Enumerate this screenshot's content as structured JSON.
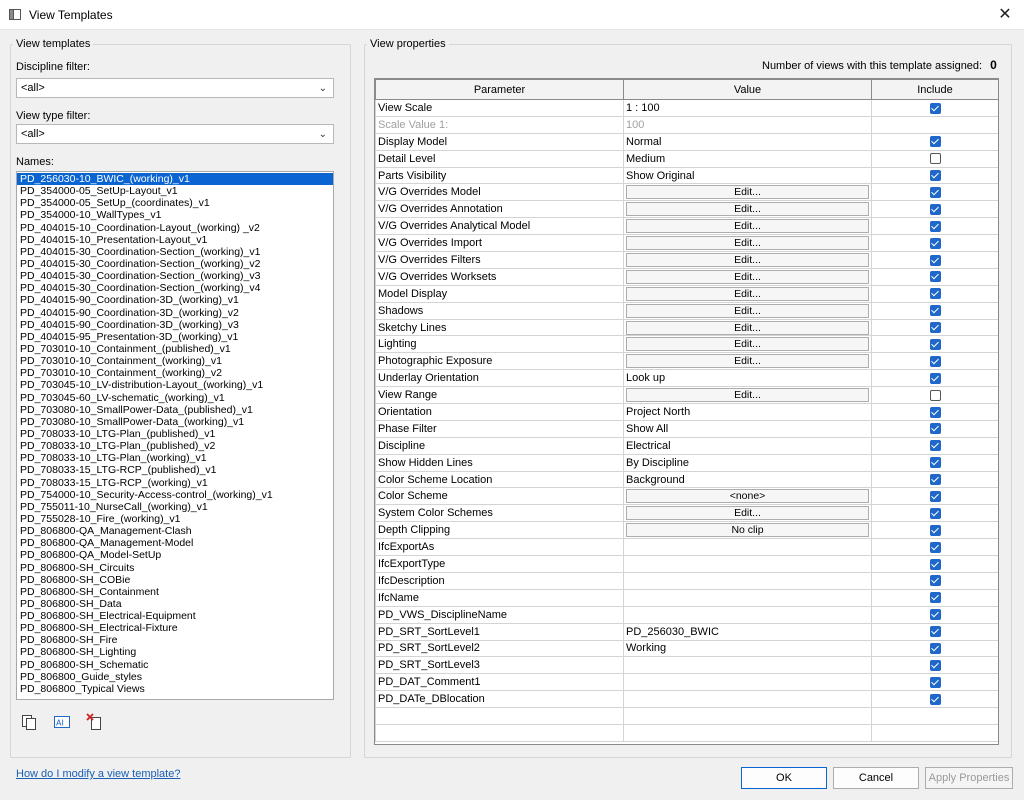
{
  "window": {
    "title": "View Templates"
  },
  "left": {
    "group_label": "View templates",
    "discipline_label": "Discipline filter:",
    "discipline_value": "<all>",
    "viewtype_label": "View type filter:",
    "viewtype_value": "<all>",
    "names_label": "Names:",
    "names": [
      "PD_256030-10_BWIC_(working)_v1",
      "PD_354000-05_SetUp-Layout_v1",
      "PD_354000-05_SetUp_(coordinates)_v1",
      "PD_354000-10_WallTypes_v1",
      "PD_404015-10_Coordination-Layout_(working) _v2",
      "PD_404015-10_Presentation-Layout_v1",
      "PD_404015-30_Coordination-Section_(working)_v1",
      "PD_404015-30_Coordination-Section_(working)_v2",
      "PD_404015-30_Coordination-Section_(working)_v3",
      "PD_404015-30_Coordination-Section_(working)_v4",
      "PD_404015-90_Coordination-3D_(working)_v1",
      "PD_404015-90_Coordination-3D_(working)_v2",
      "PD_404015-90_Coordination-3D_(working)_v3",
      "PD_404015-95_Presentation-3D_(working)_v1",
      "PD_703010-10_Containment_(published)_v1",
      "PD_703010-10_Containment_(working)_v1",
      "PD_703010-10_Containment_(working)_v2",
      "PD_703045-10_LV-distribution-Layout_(working)_v1",
      "PD_703045-60_LV-schematic_(working)_v1",
      "PD_703080-10_SmallPower-Data_(published)_v1",
      "PD_703080-10_SmallPower-Data_(working)_v1",
      "PD_708033-10_LTG-Plan_(published)_v1",
      "PD_708033-10_LTG-Plan_(published)_v2",
      "PD_708033-10_LTG-Plan_(working)_v1",
      "PD_708033-15_LTG-RCP_(published)_v1",
      "PD_708033-15_LTG-RCP_(working)_v1",
      "PD_754000-10_Security-Access-control_(working)_v1",
      "PD_755011-10_NurseCall_(working)_v1",
      "PD_755028-10_Fire_(working)_v1",
      "PD_806800-QA_Management-Clash",
      "PD_806800-QA_Management-Model",
      "PD_806800-QA_Model-SetUp",
      "PD_806800-SH_Circuits",
      "PD_806800-SH_COBie",
      "PD_806800-SH_Containment",
      "PD_806800-SH_Data",
      "PD_806800-SH_Electrical-Equipment",
      "PD_806800-SH_Electrical-Fixture",
      "PD_806800-SH_Fire",
      "PD_806800-SH_Lighting",
      "PD_806800-SH_Schematic",
      "PD_806800_Guide_styles",
      "PD_806800_Typical Views"
    ],
    "selected_index": 0,
    "help_link": "How do I modify a view template?"
  },
  "right": {
    "group_label": "View properties",
    "views_assigned_label": "Number of views with this template assigned:",
    "views_assigned_count": "0",
    "columns": [
      "Parameter",
      "Value",
      "Include"
    ],
    "rows": [
      {
        "param": "View Scale",
        "value": "1 : 100",
        "kind": "text",
        "include": true
      },
      {
        "param": "Scale Value    1:",
        "value": "100",
        "kind": "text",
        "include": null,
        "dim": true
      },
      {
        "param": "Display Model",
        "value": "Normal",
        "kind": "text",
        "include": true
      },
      {
        "param": "Detail Level",
        "value": "Medium",
        "kind": "text",
        "include": false
      },
      {
        "param": "Parts Visibility",
        "value": "Show Original",
        "kind": "text",
        "include": true
      },
      {
        "param": "V/G Overrides Model",
        "value": "Edit...",
        "kind": "button",
        "include": true
      },
      {
        "param": "V/G Overrides Annotation",
        "value": "Edit...",
        "kind": "button",
        "include": true
      },
      {
        "param": "V/G Overrides Analytical Model",
        "value": "Edit...",
        "kind": "button",
        "include": true
      },
      {
        "param": "V/G Overrides Import",
        "value": "Edit...",
        "kind": "button",
        "include": true
      },
      {
        "param": "V/G Overrides Filters",
        "value": "Edit...",
        "kind": "button",
        "include": true
      },
      {
        "param": "V/G Overrides Worksets",
        "value": "Edit...",
        "kind": "button",
        "include": true
      },
      {
        "param": "Model Display",
        "value": "Edit...",
        "kind": "button",
        "include": true
      },
      {
        "param": "Shadows",
        "value": "Edit...",
        "kind": "button",
        "include": true
      },
      {
        "param": "Sketchy Lines",
        "value": "Edit...",
        "kind": "button",
        "include": true
      },
      {
        "param": "Lighting",
        "value": "Edit...",
        "kind": "button",
        "include": true
      },
      {
        "param": "Photographic Exposure",
        "value": "Edit...",
        "kind": "button",
        "include": true
      },
      {
        "param": "Underlay Orientation",
        "value": "Look up",
        "kind": "text",
        "include": true
      },
      {
        "param": "View Range",
        "value": "Edit...",
        "kind": "button",
        "include": false
      },
      {
        "param": "Orientation",
        "value": "Project North",
        "kind": "text",
        "include": true
      },
      {
        "param": "Phase Filter",
        "value": "Show All",
        "kind": "text",
        "include": true
      },
      {
        "param": "Discipline",
        "value": "Electrical",
        "kind": "text",
        "include": true
      },
      {
        "param": "Show Hidden Lines",
        "value": "By Discipline",
        "kind": "text",
        "include": true
      },
      {
        "param": "Color Scheme Location",
        "value": "Background",
        "kind": "text",
        "include": true
      },
      {
        "param": "Color Scheme",
        "value": "<none>",
        "kind": "button",
        "include": true
      },
      {
        "param": "System Color Schemes",
        "value": "Edit...",
        "kind": "button",
        "include": true
      },
      {
        "param": "Depth Clipping",
        "value": "No clip",
        "kind": "button",
        "include": true
      },
      {
        "param": "IfcExportAs",
        "value": "",
        "kind": "text",
        "include": true
      },
      {
        "param": "IfcExportType",
        "value": "",
        "kind": "text",
        "include": true
      },
      {
        "param": "IfcDescription",
        "value": "",
        "kind": "text",
        "include": true
      },
      {
        "param": "IfcName",
        "value": "",
        "kind": "text",
        "include": true
      },
      {
        "param": "PD_VWS_DisciplineName",
        "value": "",
        "kind": "text",
        "include": true
      },
      {
        "param": "PD_SRT_SortLevel1",
        "value": "PD_256030_BWIC",
        "kind": "text",
        "include": true
      },
      {
        "param": "PD_SRT_SortLevel2",
        "value": "Working",
        "kind": "text",
        "include": true
      },
      {
        "param": "PD_SRT_SortLevel3",
        "value": "",
        "kind": "text",
        "include": true
      },
      {
        "param": "PD_DAT_Comment1",
        "value": "",
        "kind": "text",
        "include": true
      },
      {
        "param": "PD_DATe_DBlocation",
        "value": "",
        "kind": "text",
        "include": true
      }
    ]
  },
  "footer": {
    "ok": "OK",
    "cancel": "Cancel",
    "apply": "Apply Properties"
  },
  "colors": {
    "accent": "#0a64d2",
    "checkbox": "#1f67c8",
    "link": "#1a5fb4"
  }
}
